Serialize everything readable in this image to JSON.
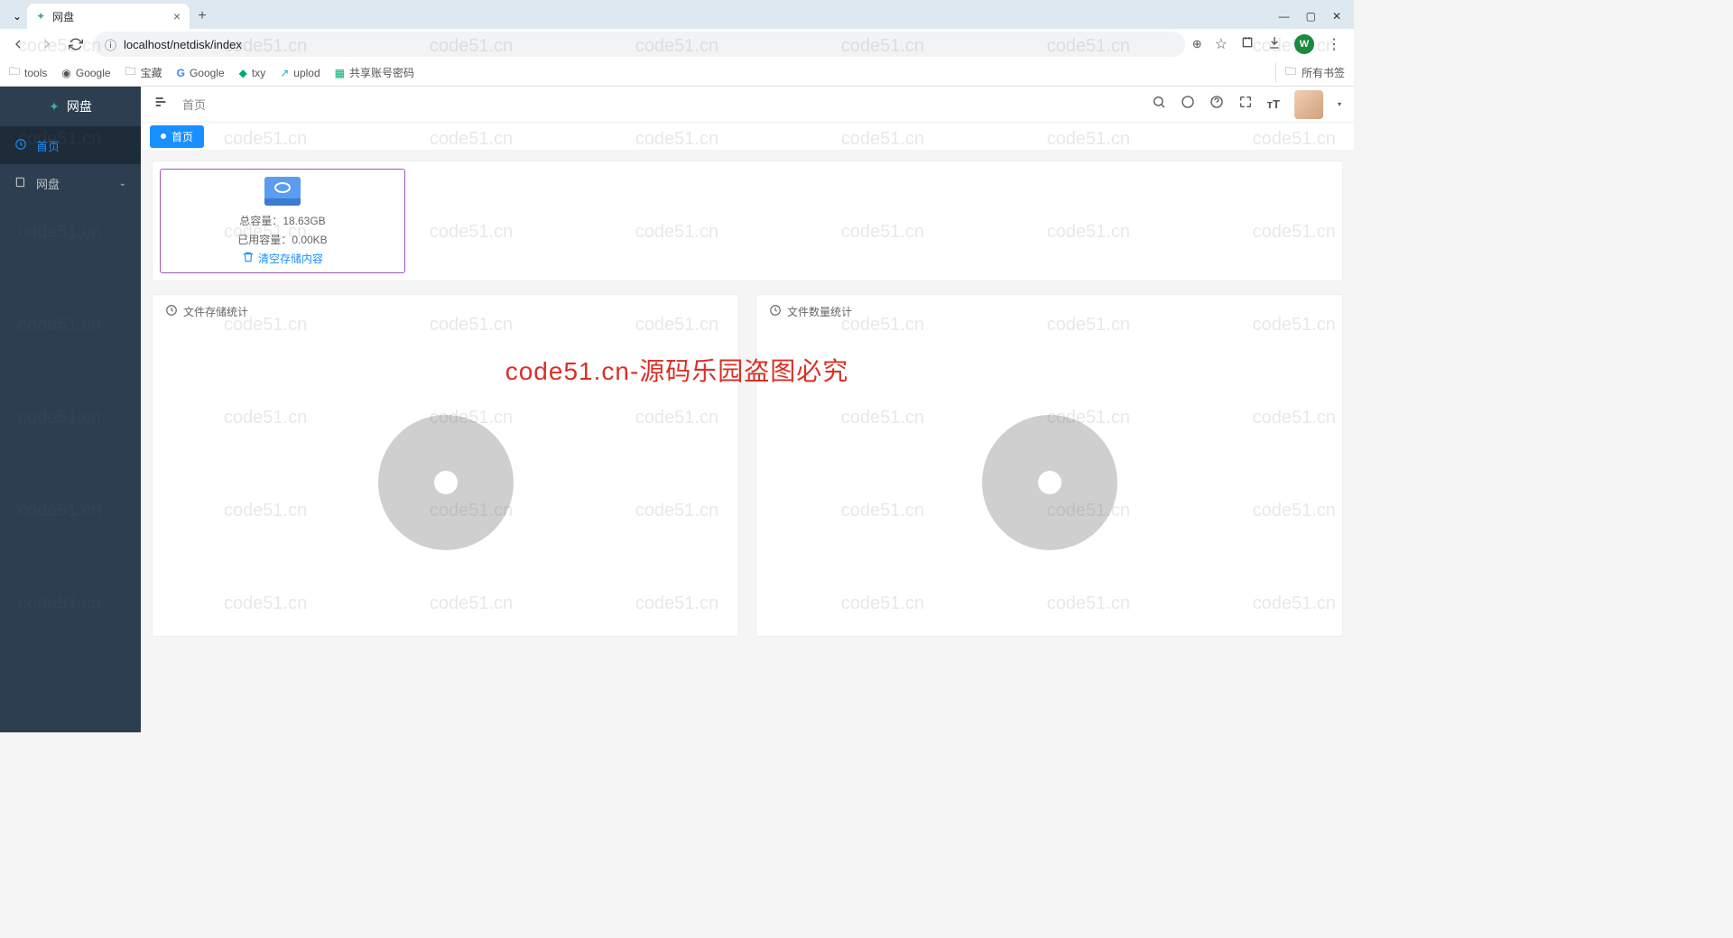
{
  "browser": {
    "tab_title": "网盘",
    "url": "localhost/netdisk/index",
    "window": {
      "min": "—",
      "max": "▢",
      "close": "✕"
    },
    "profile_letter": "W",
    "bookmarks": [
      {
        "icon": "folder",
        "label": "tools"
      },
      {
        "icon": "globe",
        "label": "Google"
      },
      {
        "icon": "folder",
        "label": "宝藏"
      },
      {
        "icon": "g",
        "label": "Google"
      },
      {
        "icon": "t",
        "label": "txy"
      },
      {
        "icon": "up",
        "label": "uplod"
      },
      {
        "icon": "sheet",
        "label": "共享账号密码"
      }
    ],
    "all_bookmarks": "所有书签"
  },
  "sidebar": {
    "logo": "网盘",
    "items": [
      {
        "icon": "dashboard",
        "label": "首页",
        "active": true
      },
      {
        "icon": "book",
        "label": "网盘",
        "expandable": true
      }
    ]
  },
  "topbar": {
    "breadcrumb": "首页"
  },
  "page_tab": "首页",
  "storage": {
    "total_label": "总容量：",
    "total_value": "18.63GB",
    "used_label": "已用容量：",
    "used_value": "0.00KB",
    "clear_label": "清空存储内容"
  },
  "panels": {
    "left_title": "文件存储统计",
    "right_title": "文件数量统计"
  },
  "watermark_text": "code51.cn",
  "overlay_text": "code51.cn-源码乐园盗图必究"
}
